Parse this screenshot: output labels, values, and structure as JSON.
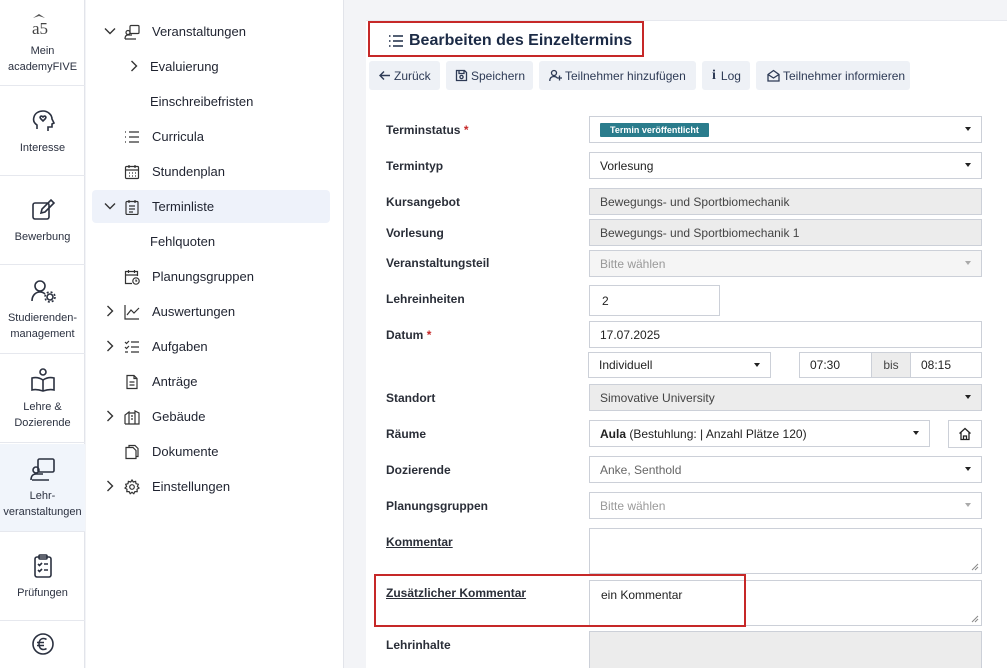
{
  "rail": {
    "items": [
      {
        "label": "Mein academyFIVE",
        "line1": "Mein",
        "line2": "academyFIVE",
        "icon": "a5-logo-icon"
      },
      {
        "label": "Interesse",
        "line1": "Interesse",
        "line2": "",
        "icon": "head-heart-icon"
      },
      {
        "label": "Bewerbung",
        "line1": "Bewerbung",
        "line2": "",
        "icon": "edit-icon"
      },
      {
        "label": "Studierenden-management",
        "line1": "Studierenden-",
        "line2": "management",
        "icon": "user-gear-icon"
      },
      {
        "label": "Lehre & Dozierende",
        "line1": "Lehre &",
        "line2": "Dozierende",
        "icon": "book-user-icon"
      },
      {
        "label": "Lehr-veranstaltungen",
        "line1": "Lehr-",
        "line2": "veranstaltungen",
        "icon": "presentation-icon"
      },
      {
        "label": "Prüfungen",
        "line1": "Prüfungen",
        "line2": "",
        "icon": "clipboard-icon"
      },
      {
        "label": "",
        "line1": "",
        "line2": "",
        "icon": "euro-icon"
      }
    ]
  },
  "nav": {
    "items": [
      {
        "label": "Veranstaltungen",
        "icon": "presentation-icon",
        "chevron": "down"
      },
      {
        "label": "Evaluierung",
        "icon": "",
        "chevron": "right"
      },
      {
        "label": "Einschreibefristen",
        "icon": "",
        "chevron": ""
      },
      {
        "label": "Curricula",
        "icon": "list-icon",
        "chevron": ""
      },
      {
        "label": "Stundenplan",
        "icon": "calendar-icon",
        "chevron": ""
      },
      {
        "label": "Terminliste",
        "icon": "clipboard-list-icon",
        "chevron": "down"
      },
      {
        "label": "Fehlquoten",
        "icon": "",
        "chevron": ""
      },
      {
        "label": "Planungsgruppen",
        "icon": "calendar-clock-icon",
        "chevron": ""
      },
      {
        "label": "Auswertungen",
        "icon": "chart-line-icon",
        "chevron": "right"
      },
      {
        "label": "Aufgaben",
        "icon": "checklist-icon",
        "chevron": "right"
      },
      {
        "label": "Anträge",
        "icon": "document-icon",
        "chevron": ""
      },
      {
        "label": "Gebäude",
        "icon": "building-icon",
        "chevron": "right"
      },
      {
        "label": "Dokumente",
        "icon": "documents-icon",
        "chevron": ""
      },
      {
        "label": "Einstellungen",
        "icon": "gear-icon",
        "chevron": "right"
      }
    ]
  },
  "page": {
    "title": "Bearbeiten des Einzeltermins",
    "toolbar": {
      "back": "Zurück",
      "save": "Speichern",
      "add_participants": "Teilnehmer hinzufügen",
      "log": "Log",
      "inform": "Teilnehmer informieren"
    }
  },
  "form": {
    "terminstatus": {
      "label": "Terminstatus",
      "required": "*",
      "value": "Termin veröffentlicht"
    },
    "termintyp": {
      "label": "Termintyp",
      "value": "Vorlesung"
    },
    "kursangebot": {
      "label": "Kursangebot",
      "value": "Bewegungs- und Sportbiomechanik"
    },
    "vorlesung": {
      "label": "Vorlesung",
      "value": "Bewegungs- und Sportbiomechanik 1"
    },
    "veranstaltungsteil": {
      "label": "Veranstaltungsteil",
      "placeholder": "Bitte wählen"
    },
    "lehreinheiten": {
      "label": "Lehreinheiten",
      "value": "2"
    },
    "datum": {
      "label": "Datum",
      "required": "*",
      "value": "17.07.2025",
      "mode": "Individuell",
      "from": "07:30",
      "bis": "bis",
      "to": "08:15"
    },
    "standort": {
      "label": "Standort",
      "value": "Simovative University"
    },
    "raeume": {
      "label": "Räume",
      "value_bold": "Aula",
      "value_rest": " (Bestuhlung: | Anzahl Plätze 120)"
    },
    "dozierende": {
      "label": "Dozierende",
      "value": "Anke, Senthold"
    },
    "planungsgruppen": {
      "label": "Planungsgruppen",
      "placeholder": "Bitte wählen"
    },
    "kommentar": {
      "label": "Kommentar",
      "value": ""
    },
    "zusatz_kommentar": {
      "label": "Zusätzlicher Kommentar",
      "value": "ein Kommentar"
    },
    "lehrinhalte": {
      "label": "Lehrinhalte",
      "value": ""
    }
  },
  "colors": {
    "accent": "#c62828",
    "badge": "#2a7c8c",
    "title": "#1c2b46"
  }
}
